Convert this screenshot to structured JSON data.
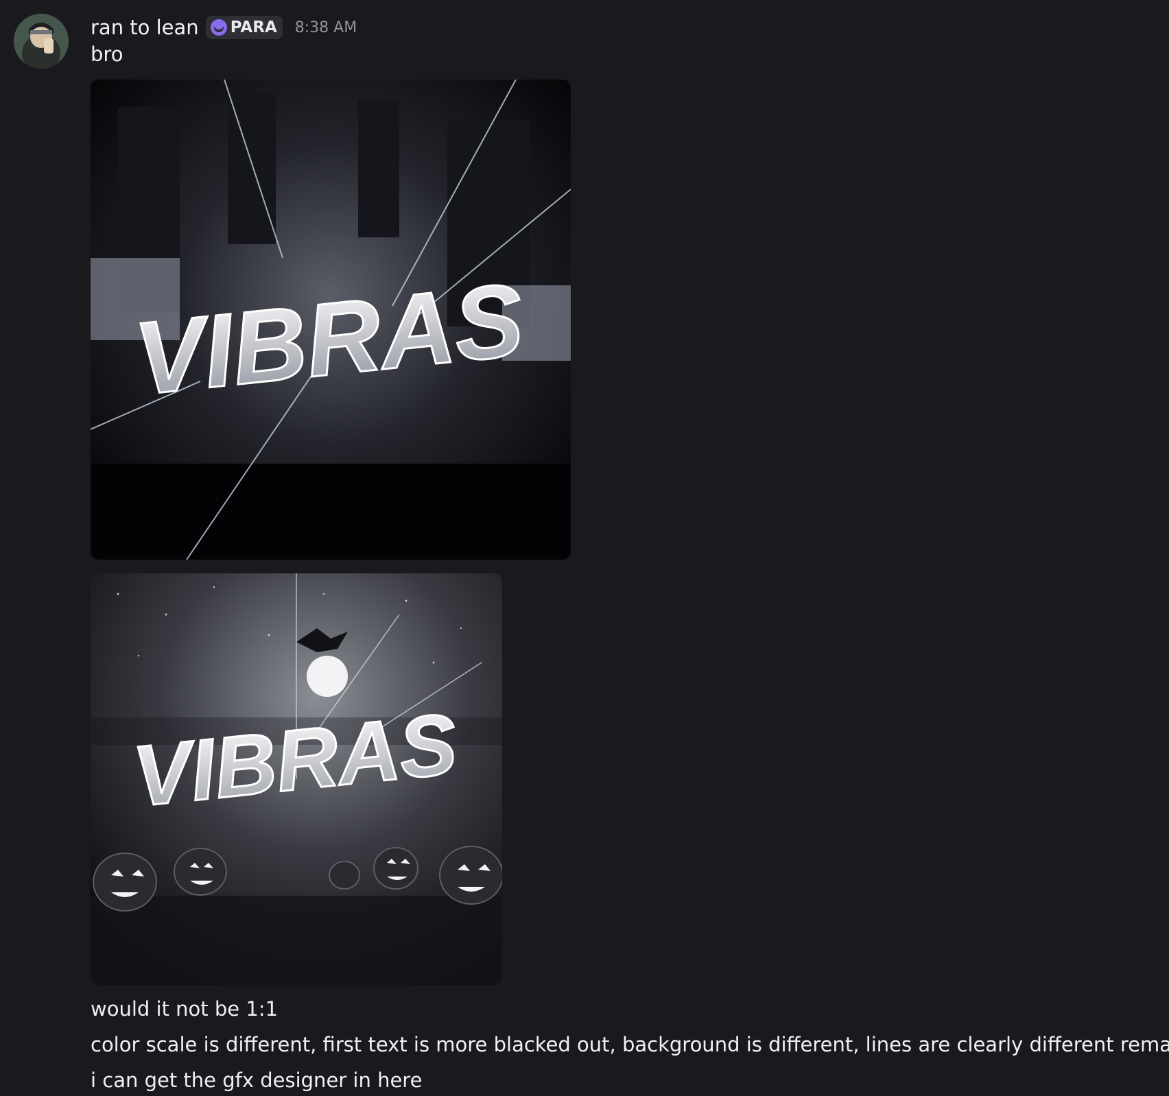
{
  "message": {
    "username": "ran to lean",
    "tag": {
      "label": "PARA",
      "icon": "moon-badge-icon",
      "color": "#8a6bf0"
    },
    "timestamp": "8:38 AM",
    "first_line": "bro",
    "attachments": [
      {
        "name": "vibras-graphic-original",
        "logo_text": "VIBRAS",
        "style": "dark city glass shards"
      },
      {
        "name": "vibras-graphic-halloween",
        "logo_text": "VIBRAS",
        "style": "halloween pumpkins and moon"
      }
    ],
    "lines": [
      "would it not be 1:1",
      "color scale is different, first text is more blacked out, background is different, lines are clearly different remade",
      "i can get the gfx designer in here"
    ]
  }
}
